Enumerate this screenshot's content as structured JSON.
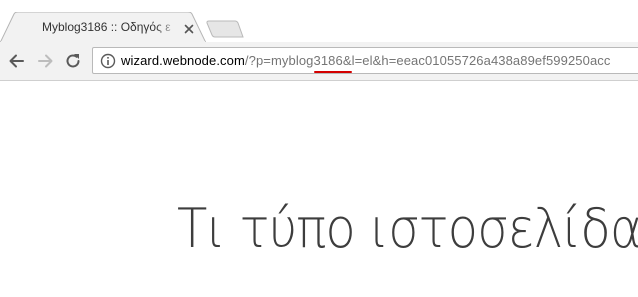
{
  "tab": {
    "title": "Myblog3186 :: Οδηγός ε",
    "close_icon": "close-icon"
  },
  "toolbar": {
    "back_icon": "back-arrow-icon",
    "forward_icon": "forward-arrow-icon",
    "reload_icon": "reload-icon"
  },
  "address_bar": {
    "info_icon": "info-icon",
    "url_host": "wizard.webnode.com",
    "url_path_before": "/?p=myblog",
    "url_highlight": "3186&",
    "url_path_after": "l=el&h=eeac01055726a438a89ef599250acc"
  },
  "page": {
    "heading": "Τι τύπο ιστοσελίδας"
  },
  "colors": {
    "toolbar_bg": "#f2f2f2",
    "highlight_underline": "#d40000",
    "heading_text": "#3d3d3d"
  }
}
